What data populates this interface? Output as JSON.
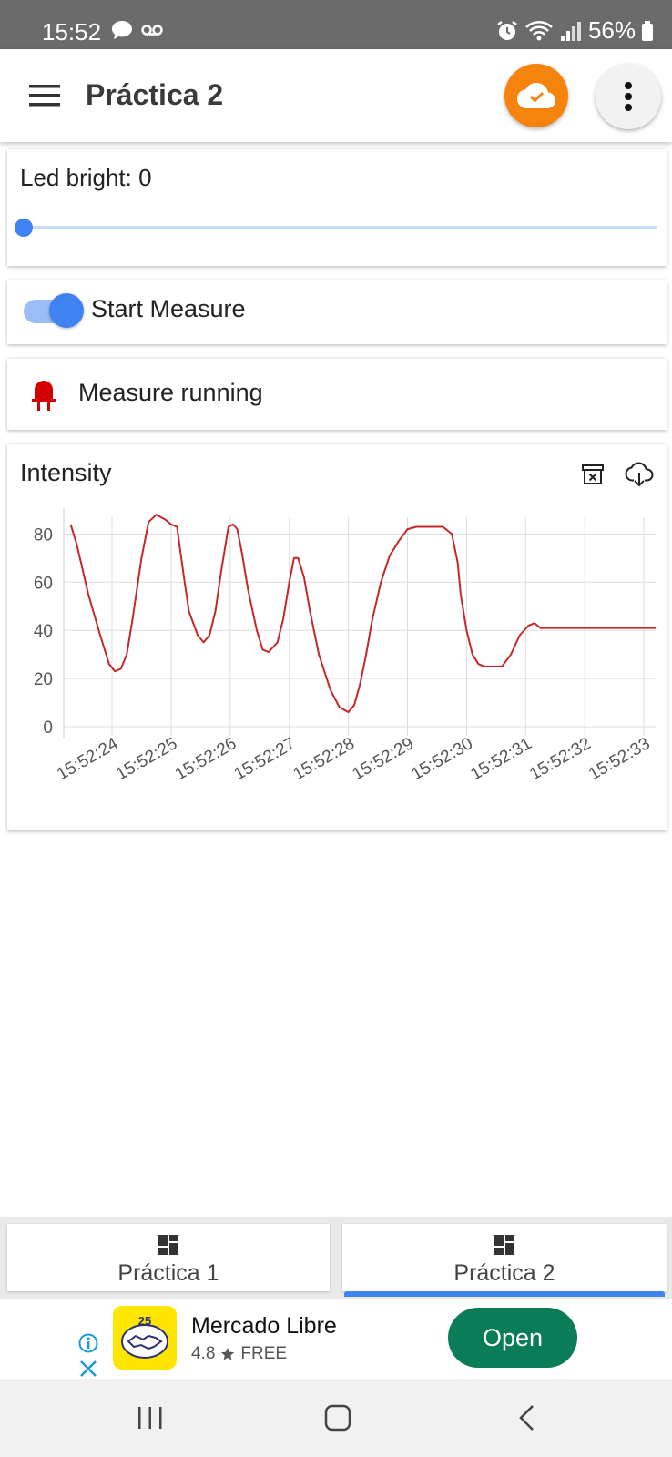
{
  "status_bar": {
    "time": "15:52",
    "battery": "56%",
    "icons": [
      "chat-bubble-icon",
      "voicemail-icon",
      "alarm-icon",
      "wifi-icon",
      "signal-icon",
      "battery-icon"
    ]
  },
  "app_bar": {
    "title": "Práctica 2",
    "icons": [
      "menu-icon",
      "cloud-check-icon",
      "more-vert-icon"
    ],
    "cloud_button_color": "#f5840f"
  },
  "slider": {
    "label": "Led bright: 0",
    "value": 0,
    "accent": "#3f82f1"
  },
  "switch": {
    "label": "Start Measure",
    "on": true
  },
  "status": {
    "label": "Measure running",
    "icon": "led-icon",
    "icon_color": "#d50000"
  },
  "chart": {
    "title": "Intensity",
    "actions": [
      "trash-icon",
      "cloud-download-icon"
    ],
    "line_color": "#c62828"
  },
  "chart_data": {
    "type": "line",
    "title": "Intensity",
    "xlabel": "",
    "ylabel": "",
    "x_ticks": [
      "15:52:24",
      "15:52:25",
      "15:52:26",
      "15:52:27",
      "15:52:28",
      "15:52:29",
      "15:52:30",
      "15:52:31",
      "15:52:32",
      "15:52:33"
    ],
    "y_ticks": [
      0,
      20,
      40,
      60,
      80
    ],
    "ylim": [
      0,
      90
    ],
    "grid": true,
    "series": [
      {
        "x": [
          23.3,
          23.4,
          23.6,
          23.8,
          23.95,
          24.05,
          24.15,
          24.25,
          24.35,
          24.5,
          24.62,
          24.75,
          24.9,
          25.0,
          25.1,
          25.2,
          25.3,
          25.45,
          25.55,
          25.65,
          25.75,
          25.85,
          25.97,
          26.05,
          26.12,
          26.2,
          26.3,
          26.45,
          26.55,
          26.65,
          26.8,
          26.9,
          27.0,
          27.08,
          27.15,
          27.25,
          27.35,
          27.5,
          27.7,
          27.85,
          28.0,
          28.1,
          28.2,
          28.3,
          28.4,
          28.55,
          28.7,
          28.85,
          29.0,
          29.15,
          29.3,
          29.45,
          29.6,
          29.75,
          29.85,
          29.9,
          30.0,
          30.1,
          30.2,
          30.3,
          30.45,
          30.6,
          30.75,
          30.9,
          31.05,
          31.15,
          31.25,
          31.4,
          31.6,
          31.8,
          32.0,
          32.2,
          32.5,
          32.8,
          33.0,
          33.2
        ],
        "y": [
          84,
          76,
          55,
          38,
          26,
          23,
          24,
          30,
          45,
          70,
          85,
          88,
          86,
          84,
          83,
          65,
          48,
          38,
          35,
          38,
          48,
          65,
          83,
          84,
          82,
          72,
          57,
          40,
          32,
          31,
          35,
          45,
          60,
          70,
          70,
          62,
          48,
          30,
          15,
          8,
          6,
          9,
          18,
          30,
          44,
          60,
          71,
          77,
          82,
          83,
          83,
          83,
          83,
          80,
          68,
          55,
          40,
          30,
          26,
          25,
          25,
          25,
          30,
          38,
          42,
          43,
          41,
          41,
          41,
          41,
          41,
          41,
          41,
          41,
          41,
          41
        ]
      }
    ]
  },
  "tabs": [
    {
      "label": "Práctica 1",
      "active": false,
      "icon": "dashboard-icon"
    },
    {
      "label": "Práctica 2",
      "active": true,
      "icon": "dashboard-icon"
    }
  ],
  "ad": {
    "name": "Mercado Libre",
    "rating": "4.8",
    "price": "FREE",
    "cta": "Open",
    "logo_color": "#ffe600",
    "cta_color": "#0a7c57"
  },
  "nav": {
    "icons": [
      "recents-icon",
      "home-icon",
      "back-icon"
    ]
  }
}
